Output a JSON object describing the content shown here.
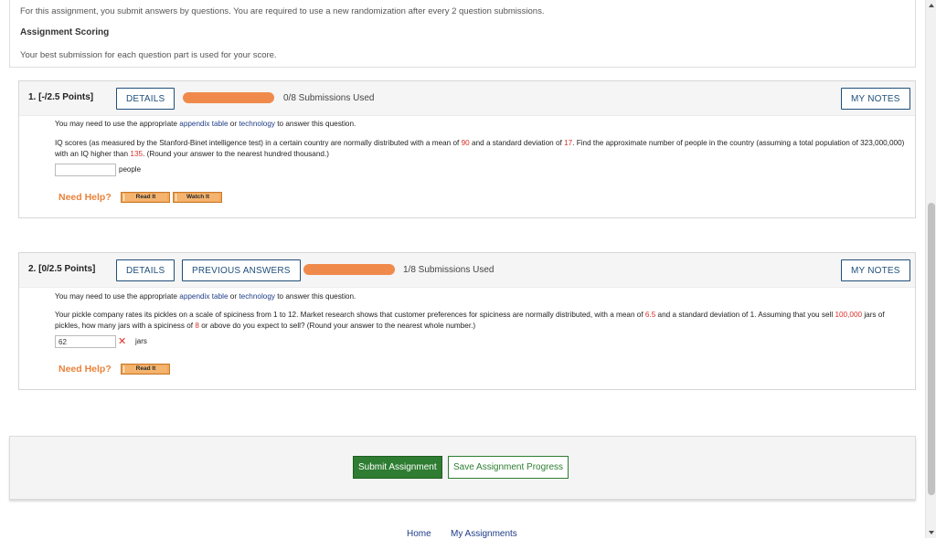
{
  "info": {
    "line1": "For this assignment, you submit answers by questions. You are required to use a new randomization after every 2 question submissions.",
    "scoring_heading": "Assignment Scoring",
    "scoring_text": "Your best submission for each question part is used for your score."
  },
  "questions": [
    {
      "label": "1. [-/2.5 Points]",
      "details_label": "DETAILS",
      "submissions": "0/8 Submissions Used",
      "notes_label": "MY NOTES",
      "intro": {
        "before": "You may need to use the appropriate ",
        "link1": "appendix table",
        "mid": " or ",
        "link2": "technology",
        "after": " to answer this question."
      },
      "body": {
        "p1": "IQ scores (as measured by the Stanford-Binet intelligence test) in a certain country are normally distributed with a mean of ",
        "mean": "90",
        "p2": " and a standard deviation of ",
        "sd": "17",
        "p3": ". Find the approximate number of people in the country (assuming a total population of 323,000,000) with an IQ higher than ",
        "threshold": "135",
        "p4": ". (Round your answer to the nearest hundred thousand.)"
      },
      "answer_value": "",
      "unit": "people",
      "need_help": "Need Help?",
      "help_buttons": [
        "Read It",
        "Watch It"
      ]
    },
    {
      "label": "2. [0/2.5 Points]",
      "details_label": "DETAILS",
      "previous_label": "PREVIOUS ANSWERS",
      "submissions": "1/8 Submissions Used",
      "notes_label": "MY NOTES",
      "intro": {
        "before": "You may need to use the appropriate ",
        "link1": "appendix table",
        "mid": " or ",
        "link2": "technology",
        "after": " to answer this question."
      },
      "body": {
        "p1": "Your pickle company rates its pickles on a scale of spiciness from 1 to 12. Market research shows that customer preferences for spiciness are normally distributed, with a mean of ",
        "mean": "6.5",
        "p2": " and a standard deviation of 1. Assuming that you sell ",
        "jars": "100,000",
        "p3": " jars of pickles, how many jars with a spiciness of ",
        "threshold": "8",
        "p4": " or above do you expect to sell? (Round your answer to the nearest whole number.)"
      },
      "answer_value": "62",
      "unit": "jars",
      "need_help": "Need Help?",
      "help_buttons": [
        "Read It"
      ]
    }
  ],
  "actions": {
    "submit_label": "Submit Assignment",
    "save_label": "Save Assignment Progress"
  },
  "footer": {
    "home": "Home",
    "my_assignments": "My Assignments"
  },
  "colors": {
    "accent_blue": "#1f4e79",
    "submit_green": "#2e7d32",
    "redaction": "#f08a4b",
    "error_red": "#d9302a",
    "help_orange": "#e9823a"
  }
}
